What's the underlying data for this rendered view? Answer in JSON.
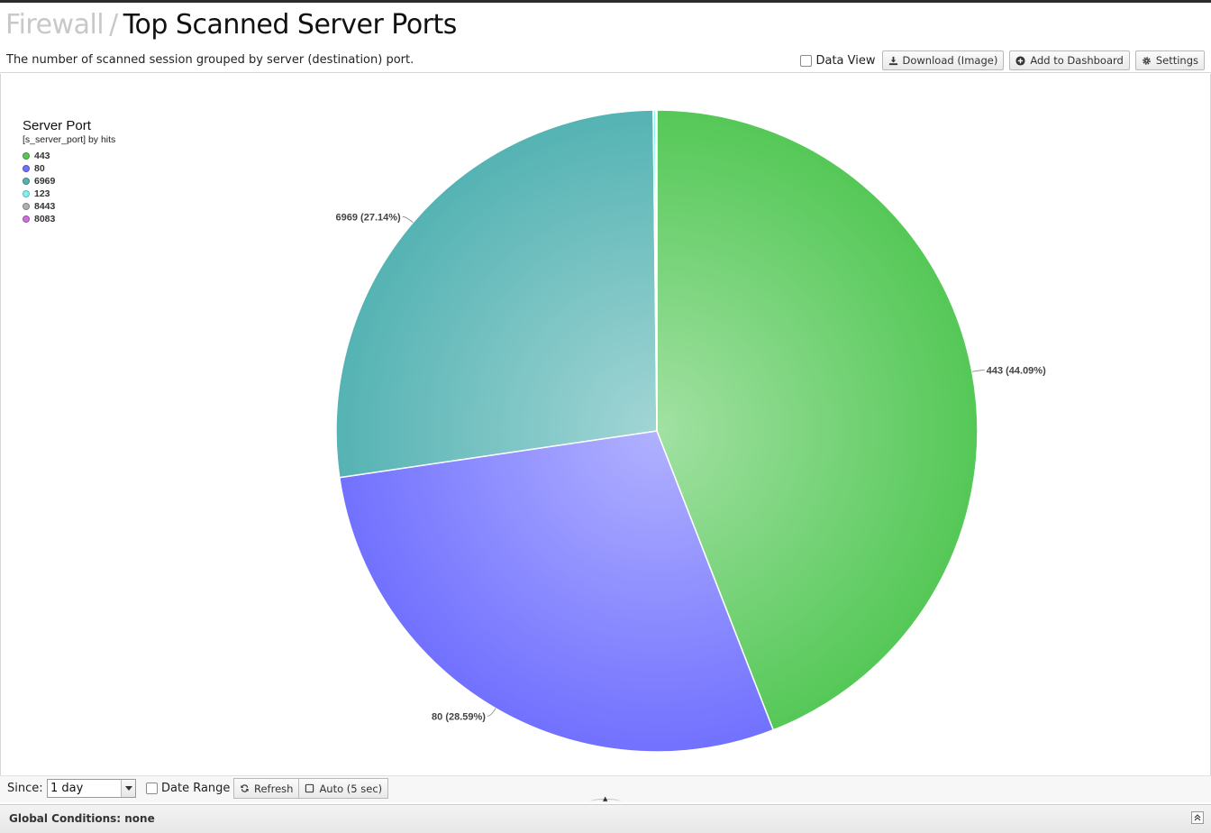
{
  "header": {
    "breadcrumb": "Firewall",
    "separator": "/",
    "page_title": "Top Scanned Server Ports",
    "description": "The number of scanned session grouped by server (destination) port."
  },
  "toolbar": {
    "data_view_label": "Data View",
    "download_label": "Download (Image)",
    "add_dashboard_label": "Add to Dashboard",
    "settings_label": "Settings"
  },
  "legend": {
    "title": "Server Port",
    "subtitle": "[s_server_port] by hits",
    "placement": "top-left",
    "items": [
      {
        "label": "443",
        "color": "#55c857"
      },
      {
        "label": "80",
        "color": "#7171ff"
      },
      {
        "label": "6969",
        "color": "#55b3b3"
      },
      {
        "label": "123",
        "color": "#7ff3f3"
      },
      {
        "label": "8443",
        "color": "#b0b0b0"
      },
      {
        "label": "8083",
        "color": "#cf6fd8"
      }
    ]
  },
  "chart_data": {
    "type": "pie",
    "categories": [
      "443",
      "80",
      "6969",
      "123",
      "8443",
      "8083"
    ],
    "values": [
      44.09,
      28.59,
      27.14,
      0.12,
      0.04,
      0.02
    ],
    "labels_shown": [
      "443 (44.09%)",
      "80 (28.59%)",
      "6969 (27.14%)"
    ],
    "colors": [
      "#55c857",
      "#7171ff",
      "#55b3b3",
      "#7ff3f3",
      "#b0b0b0",
      "#cf6fd8"
    ],
    "title": "",
    "legend": "top-left"
  },
  "footer": {
    "since_label": "Since:",
    "since_value": "1 day",
    "date_range_label": "Date Range",
    "refresh_label": "Refresh",
    "auto_label": "Auto (5 sec)"
  },
  "global": {
    "conditions_text": "Global Conditions: none"
  }
}
